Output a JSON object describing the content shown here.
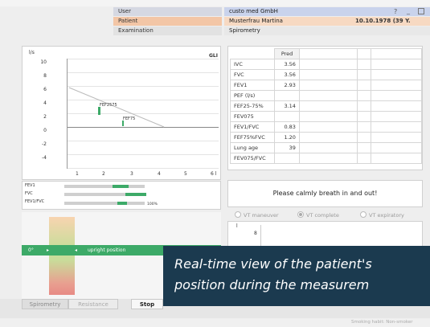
{
  "header": {
    "user_label": "User",
    "user_value": "custo med GmbH",
    "help": "?",
    "minimize": "_",
    "patient_label": "Patient",
    "patient_value": "Musterfrau Martina",
    "patient_dob": "10.10.1978 (39 Y.",
    "exam_label": "Examination",
    "exam_value": "Spirometry"
  },
  "flow_chart": {
    "y_unit": "l/s",
    "gli_label": "GLI",
    "y_ticks": [
      "10",
      "8",
      "6",
      "4",
      "2",
      "0",
      "-2",
      "-4"
    ],
    "x_ticks": [
      "1",
      "2",
      "3",
      "4",
      "5",
      "6 l"
    ],
    "marker_fef2575": "FEF2575",
    "marker_fef75": "FEF75"
  },
  "bars": {
    "rows": [
      {
        "label": "FEV1"
      },
      {
        "label": "FVC"
      },
      {
        "label": "FEV1/FVC"
      }
    ],
    "percent_label": "100%"
  },
  "params": {
    "pred_header": "Pred",
    "rows": [
      {
        "name": "IVC",
        "pred": "3.56"
      },
      {
        "name": "FVC",
        "pred": "3.56"
      },
      {
        "name": "FEV1",
        "pred": "2.93"
      },
      {
        "name": "PEF (l/s)",
        "pred": ""
      },
      {
        "name": "FEF25-75%",
        "pred": "3.14"
      },
      {
        "name": "FEV075",
        "pred": ""
      },
      {
        "name": "FEV1/FVC",
        "pred": "0.83"
      },
      {
        "name": "FEF75%FVC",
        "pred": "1.20"
      },
      {
        "name": "Lung age",
        "pred": "39"
      },
      {
        "name": "FEV075/FVC",
        "pred": ""
      }
    ]
  },
  "instruction": "Please calmly breath in and out!",
  "vt_options": {
    "maneuver": "VT maneuver",
    "complete": "VT complete",
    "expiratory": "VT expiratory"
  },
  "vt_chart": {
    "y_unit": "l",
    "y_tick": "8"
  },
  "position": {
    "angle": "0°",
    "text": "upright position"
  },
  "tabs": {
    "spirometry": "Spirometry",
    "resistance": "Resistance"
  },
  "stop_label": "Stop",
  "caption": {
    "line1": "Real-time view of the patient's",
    "line2": "position during the measurem"
  },
  "status": "Smoking habit: Non-smoker",
  "colors": {
    "accent_green": "#3daa68",
    "caption_bg": "#1b3a4f"
  }
}
